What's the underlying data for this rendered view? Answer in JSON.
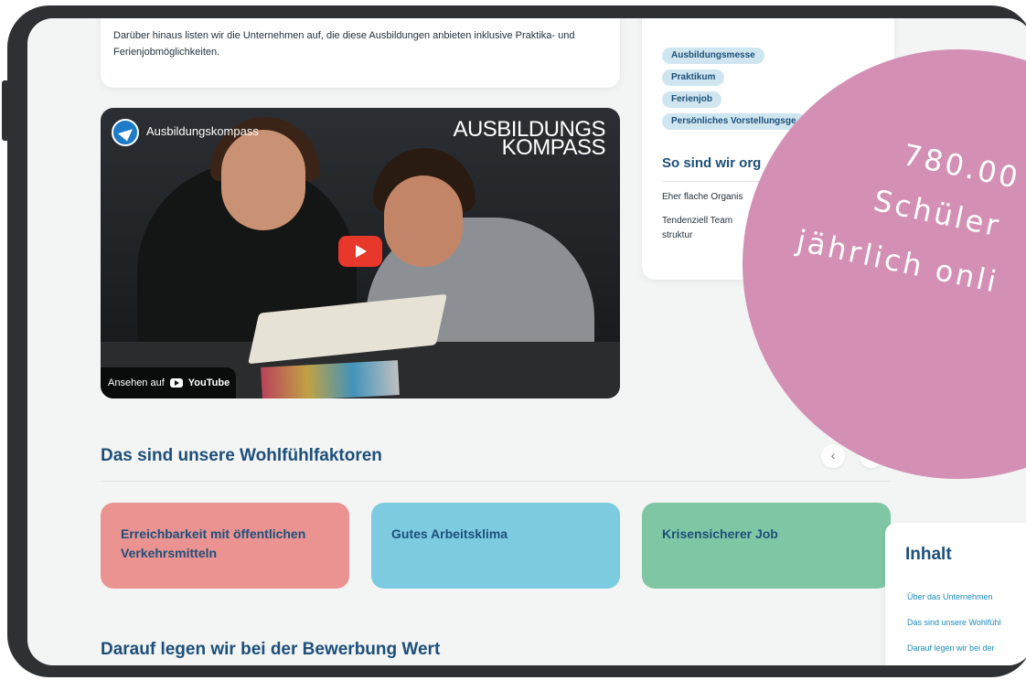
{
  "intro": {
    "text": "Darüber hinaus listen wir die Unternehmen auf, die diese Ausbildungen anbieten inklusive Praktika- und Ferienjobmöglichkeiten."
  },
  "video": {
    "title": "Ausbildungskompass",
    "brand_line1": "AUSBILDUNGS",
    "brand_line2": "KOMPASS",
    "watch_on": "Ansehen auf",
    "youtube": "YouTube"
  },
  "tags": [
    "Ausbildungsmesse",
    "Praktikum",
    "Ferienjob",
    "Persönliches Vorstellungsge"
  ],
  "organisation": {
    "title": "So sind wir org",
    "items": [
      "Eher flache Organis",
      "Tendenziell Team struktur"
    ]
  },
  "factors_section": {
    "title": "Das sind unsere Wohlfühlfaktoren",
    "prev": "‹",
    "next": "›",
    "cards": [
      {
        "label": "Erreichbarkeit mit öffentli­chen Verkehrsmitteln",
        "color": "#ea9391"
      },
      {
        "label": "Gutes Arbeitsklima",
        "color": "#7ccbe0"
      },
      {
        "label": "Krisensicherer Job",
        "color": "#7fc7a4"
      }
    ]
  },
  "application_section": {
    "title": "Darauf legen wir bei der Bewerbung Wert"
  },
  "promo": {
    "line1": "780.00",
    "line2": "Schüler",
    "line3": "jährlich onli",
    "color": "#d48fb5"
  },
  "toc": {
    "title": "Inhalt",
    "items": [
      "Über das Unternehmen",
      "Das sind unsere Wohlfühl",
      "Darauf legen wir bei der"
    ]
  }
}
